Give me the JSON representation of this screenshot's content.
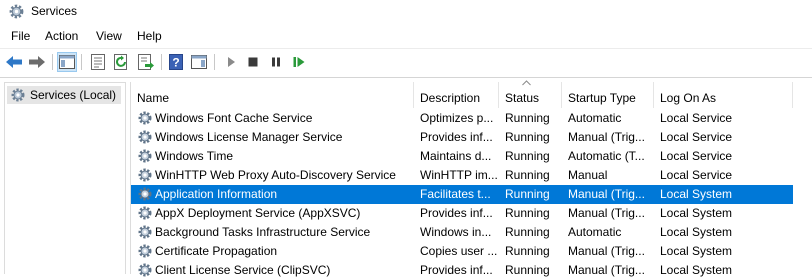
{
  "window": {
    "title": "Services"
  },
  "menu": [
    "File",
    "Action",
    "View",
    "Help"
  ],
  "tree": {
    "item": "Services (Local)"
  },
  "columns": [
    "Name",
    "Description",
    "Status",
    "Startup Type",
    "Log On As"
  ],
  "rows": [
    {
      "name": "Windows Font Cache Service",
      "description": "Optimizes p...",
      "status": "Running",
      "startup": "Automatic",
      "logon": "Local Service"
    },
    {
      "name": "Windows License Manager Service",
      "description": "Provides inf...",
      "status": "Running",
      "startup": "Manual (Trig...",
      "logon": "Local Service"
    },
    {
      "name": "Windows Time",
      "description": "Maintains d...",
      "status": "Running",
      "startup": "Automatic (T...",
      "logon": "Local Service"
    },
    {
      "name": "WinHTTP Web Proxy Auto-Discovery Service",
      "description": "WinHTTP im...",
      "status": "Running",
      "startup": "Manual",
      "logon": "Local Service"
    },
    {
      "name": "Application Information",
      "description": "Facilitates t...",
      "status": "Running",
      "startup": "Manual (Trig...",
      "logon": "Local System",
      "selected": true
    },
    {
      "name": "AppX Deployment Service (AppXSVC)",
      "description": "Provides inf...",
      "status": "Running",
      "startup": "Manual (Trig...",
      "logon": "Local System"
    },
    {
      "name": "Background Tasks Infrastructure Service",
      "description": "Windows in...",
      "status": "Running",
      "startup": "Automatic",
      "logon": "Local System"
    },
    {
      "name": "Certificate Propagation",
      "description": "Copies user ...",
      "status": "Running",
      "startup": "Manual (Trig...",
      "logon": "Local System"
    },
    {
      "name": "Client License Service (ClipSVC)",
      "description": "Provides inf...",
      "status": "Running",
      "startup": "Manual (Trig...",
      "logon": "Local System"
    }
  ],
  "colors": {
    "selection": "#0078d7",
    "tree_highlight": "#e5e5e5",
    "toolbar_active": "#cce4f7"
  },
  "icons": {
    "toolbar": [
      "back-arrow-icon",
      "forward-arrow-icon",
      "show-hide-console-tree-icon",
      "properties-icon",
      "refresh-icon",
      "export-list-icon",
      "help-icon",
      "show-hide-action-pane-icon",
      "start-service-icon",
      "stop-service-icon",
      "pause-service-icon",
      "restart-service-icon"
    ],
    "service": "gear-icon"
  }
}
